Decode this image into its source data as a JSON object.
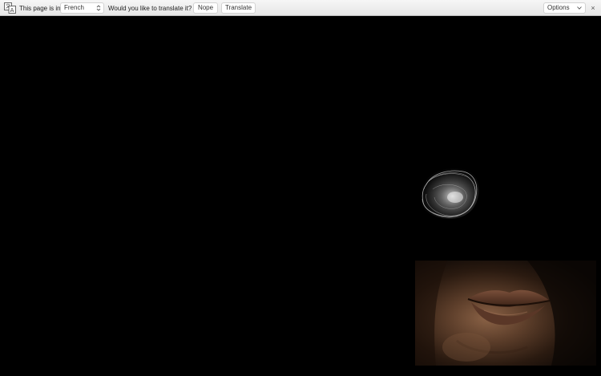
{
  "translate_bar": {
    "intro_text": "This page is in",
    "language": "French",
    "question": "Would you like to translate it?",
    "nope_label": "Nope",
    "translate_label": "Translate",
    "options_label": "Options",
    "close_glyph": "×"
  },
  "content": {
    "background": "#000000",
    "images": [
      "bubble-graphic",
      "face-photo"
    ]
  }
}
